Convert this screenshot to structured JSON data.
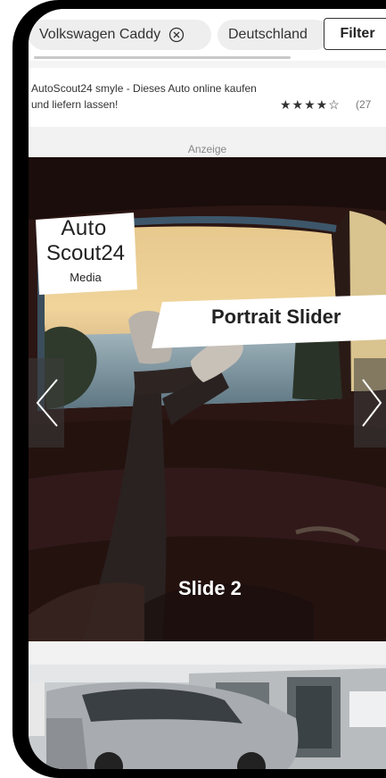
{
  "filters": {
    "chip1": "Volkswagen Caddy",
    "chip2": "Deutschland",
    "filter_button": "Filter"
  },
  "listing": {
    "text": "AutoScout24 smyle - Dieses Auto online kaufen und liefern lassen!",
    "stars": "★★★★☆",
    "rating_count": "(27"
  },
  "ad": {
    "label": "Anzeige",
    "logo_line1": "Auto",
    "logo_line2": "Scout24",
    "logo_line3": "Media",
    "headline": "Portrait Slider",
    "slide_label": "Slide 2"
  },
  "colors": {
    "chip_bg": "#eeeeee",
    "slider_bg": "#1a0f0e"
  }
}
